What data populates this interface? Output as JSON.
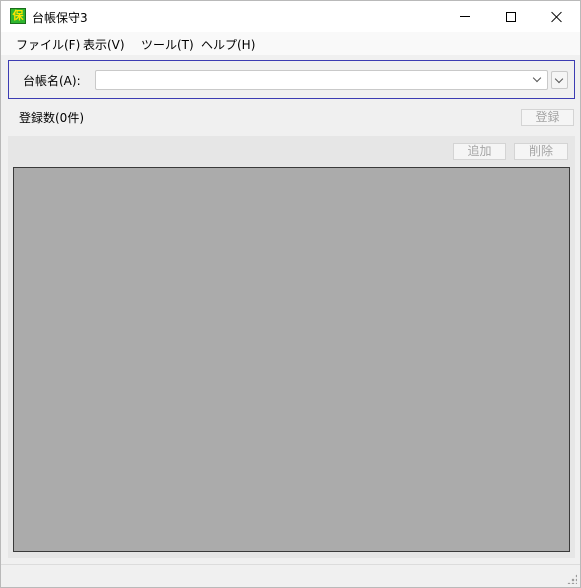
{
  "window": {
    "title": "台帳保守3",
    "icon": "ledger-app-icon",
    "icon_glyph": "保",
    "controls": {
      "minimize_icon": "minimize-icon",
      "maximize_icon": "maximize-icon",
      "close_icon": "close-icon"
    }
  },
  "menubar": {
    "items": [
      {
        "label": "ファイル(F)"
      },
      {
        "label": "表示(V)"
      },
      {
        "label": "ツール(T)"
      },
      {
        "label": "ヘルプ(H)"
      }
    ]
  },
  "ledger": {
    "label": "台帳名(A):",
    "value": ""
  },
  "count": {
    "label": "登録数(0件)"
  },
  "buttons": {
    "register": "登録",
    "add": "追加",
    "delete": "削除"
  },
  "colors": {
    "group_border": "#3c3cb3",
    "grid_background": "#ababab",
    "disabled_text": "#a5a5a5",
    "app_icon_green": "#2fb52f"
  }
}
